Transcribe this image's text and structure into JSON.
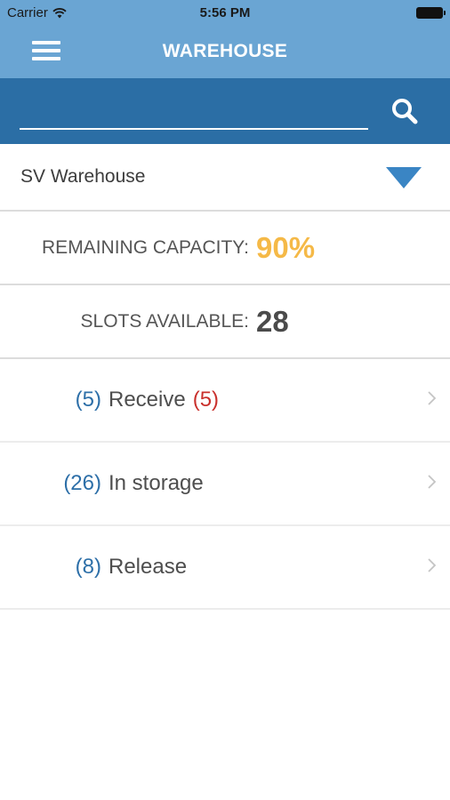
{
  "status_bar": {
    "carrier": "Carrier",
    "time": "5:56 PM",
    "icons": [
      "wifi-icon",
      "battery-icon"
    ]
  },
  "nav": {
    "title": "WAREHOUSE",
    "menu_icon": "hamburger-menu-icon"
  },
  "search": {
    "value": "",
    "placeholder": "",
    "icon": "search-icon"
  },
  "selector": {
    "selected": "SV Warehouse",
    "icon": "dropdown-triangle-icon"
  },
  "stats": {
    "capacity_label": "REMAINING CAPACITY:",
    "capacity_value": "90%",
    "slots_label": "SLOTS AVAILABLE:",
    "slots_value": "28"
  },
  "rows": [
    {
      "count": "(5)",
      "label": "Receive",
      "badge": "(5)"
    },
    {
      "count": "(26)",
      "label": "In storage",
      "badge": ""
    },
    {
      "count": "(8)",
      "label": "Release",
      "badge": ""
    }
  ],
  "colors": {
    "nav_bar": "#6aa5d3",
    "search_bar": "#2b6ea5",
    "accent_blue": "#3a85c4",
    "count_blue": "#2d6fa8",
    "capacity_orange": "#f5b947",
    "badge_red": "#c9302c"
  }
}
